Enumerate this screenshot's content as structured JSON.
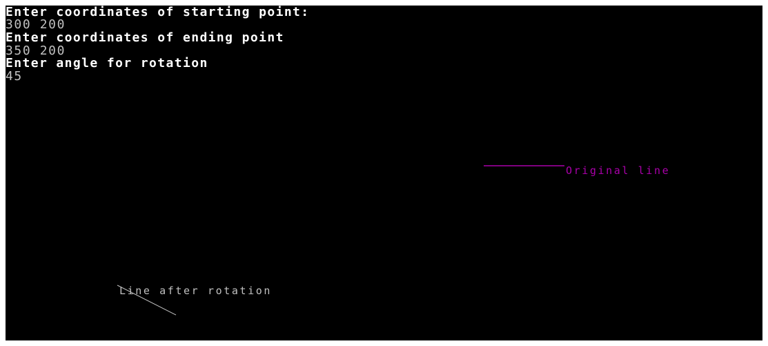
{
  "console": {
    "prompt_start": "Enter coordinates of starting point:",
    "input_start": "300 200",
    "prompt_end": "Enter coordinates of ending point",
    "input_end": "350 200",
    "prompt_angle": "Enter angle for rotation",
    "input_angle": "45"
  },
  "graphics": {
    "original_label": "Original line",
    "rotated_label": "Line after rotation"
  },
  "colors": {
    "background": "#000000",
    "console_text": "#ffffff",
    "input_text": "#c0c0c0",
    "original_line": "#aa00aa",
    "rotated_line": "#c0c0c0"
  }
}
